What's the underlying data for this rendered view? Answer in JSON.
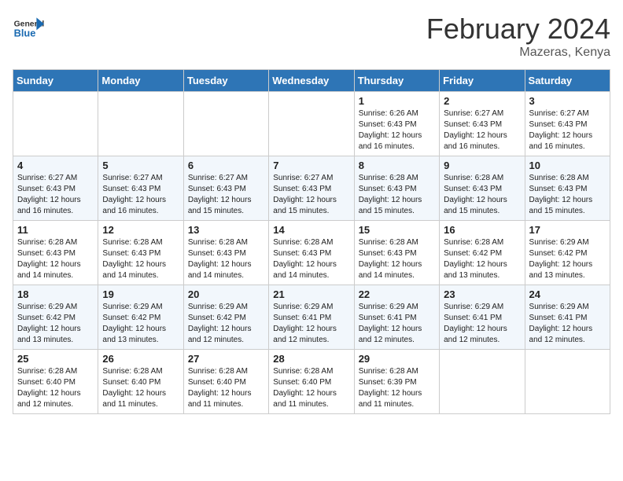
{
  "header": {
    "logo_general": "General",
    "logo_blue": "Blue",
    "month_title": "February 2024",
    "location": "Mazeras, Kenya"
  },
  "weekdays": [
    "Sunday",
    "Monday",
    "Tuesday",
    "Wednesday",
    "Thursday",
    "Friday",
    "Saturday"
  ],
  "weeks": [
    [
      {
        "day": "",
        "info": ""
      },
      {
        "day": "",
        "info": ""
      },
      {
        "day": "",
        "info": ""
      },
      {
        "day": "",
        "info": ""
      },
      {
        "day": "1",
        "info": "Sunrise: 6:26 AM\nSunset: 6:43 PM\nDaylight: 12 hours\nand 16 minutes."
      },
      {
        "day": "2",
        "info": "Sunrise: 6:27 AM\nSunset: 6:43 PM\nDaylight: 12 hours\nand 16 minutes."
      },
      {
        "day": "3",
        "info": "Sunrise: 6:27 AM\nSunset: 6:43 PM\nDaylight: 12 hours\nand 16 minutes."
      }
    ],
    [
      {
        "day": "4",
        "info": "Sunrise: 6:27 AM\nSunset: 6:43 PM\nDaylight: 12 hours\nand 16 minutes."
      },
      {
        "day": "5",
        "info": "Sunrise: 6:27 AM\nSunset: 6:43 PM\nDaylight: 12 hours\nand 16 minutes."
      },
      {
        "day": "6",
        "info": "Sunrise: 6:27 AM\nSunset: 6:43 PM\nDaylight: 12 hours\nand 15 minutes."
      },
      {
        "day": "7",
        "info": "Sunrise: 6:27 AM\nSunset: 6:43 PM\nDaylight: 12 hours\nand 15 minutes."
      },
      {
        "day": "8",
        "info": "Sunrise: 6:28 AM\nSunset: 6:43 PM\nDaylight: 12 hours\nand 15 minutes."
      },
      {
        "day": "9",
        "info": "Sunrise: 6:28 AM\nSunset: 6:43 PM\nDaylight: 12 hours\nand 15 minutes."
      },
      {
        "day": "10",
        "info": "Sunrise: 6:28 AM\nSunset: 6:43 PM\nDaylight: 12 hours\nand 15 minutes."
      }
    ],
    [
      {
        "day": "11",
        "info": "Sunrise: 6:28 AM\nSunset: 6:43 PM\nDaylight: 12 hours\nand 14 minutes."
      },
      {
        "day": "12",
        "info": "Sunrise: 6:28 AM\nSunset: 6:43 PM\nDaylight: 12 hours\nand 14 minutes."
      },
      {
        "day": "13",
        "info": "Sunrise: 6:28 AM\nSunset: 6:43 PM\nDaylight: 12 hours\nand 14 minutes."
      },
      {
        "day": "14",
        "info": "Sunrise: 6:28 AM\nSunset: 6:43 PM\nDaylight: 12 hours\nand 14 minutes."
      },
      {
        "day": "15",
        "info": "Sunrise: 6:28 AM\nSunset: 6:43 PM\nDaylight: 12 hours\nand 14 minutes."
      },
      {
        "day": "16",
        "info": "Sunrise: 6:28 AM\nSunset: 6:42 PM\nDaylight: 12 hours\nand 13 minutes."
      },
      {
        "day": "17",
        "info": "Sunrise: 6:29 AM\nSunset: 6:42 PM\nDaylight: 12 hours\nand 13 minutes."
      }
    ],
    [
      {
        "day": "18",
        "info": "Sunrise: 6:29 AM\nSunset: 6:42 PM\nDaylight: 12 hours\nand 13 minutes."
      },
      {
        "day": "19",
        "info": "Sunrise: 6:29 AM\nSunset: 6:42 PM\nDaylight: 12 hours\nand 13 minutes."
      },
      {
        "day": "20",
        "info": "Sunrise: 6:29 AM\nSunset: 6:42 PM\nDaylight: 12 hours\nand 12 minutes."
      },
      {
        "day": "21",
        "info": "Sunrise: 6:29 AM\nSunset: 6:41 PM\nDaylight: 12 hours\nand 12 minutes."
      },
      {
        "day": "22",
        "info": "Sunrise: 6:29 AM\nSunset: 6:41 PM\nDaylight: 12 hours\nand 12 minutes."
      },
      {
        "day": "23",
        "info": "Sunrise: 6:29 AM\nSunset: 6:41 PM\nDaylight: 12 hours\nand 12 minutes."
      },
      {
        "day": "24",
        "info": "Sunrise: 6:29 AM\nSunset: 6:41 PM\nDaylight: 12 hours\nand 12 minutes."
      }
    ],
    [
      {
        "day": "25",
        "info": "Sunrise: 6:28 AM\nSunset: 6:40 PM\nDaylight: 12 hours\nand 12 minutes."
      },
      {
        "day": "26",
        "info": "Sunrise: 6:28 AM\nSunset: 6:40 PM\nDaylight: 12 hours\nand 11 minutes."
      },
      {
        "day": "27",
        "info": "Sunrise: 6:28 AM\nSunset: 6:40 PM\nDaylight: 12 hours\nand 11 minutes."
      },
      {
        "day": "28",
        "info": "Sunrise: 6:28 AM\nSunset: 6:40 PM\nDaylight: 12 hours\nand 11 minutes."
      },
      {
        "day": "29",
        "info": "Sunrise: 6:28 AM\nSunset: 6:39 PM\nDaylight: 12 hours\nand 11 minutes."
      },
      {
        "day": "",
        "info": ""
      },
      {
        "day": "",
        "info": ""
      }
    ]
  ]
}
